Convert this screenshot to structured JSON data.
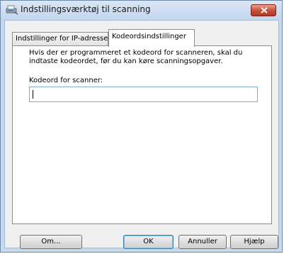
{
  "window": {
    "title": "Indstillingsværktøj til scanning"
  },
  "tabs": [
    {
      "label": "Indstillinger for IP-adresse",
      "active": false
    },
    {
      "label": "Kodeordsindstillinger",
      "active": true
    }
  ],
  "panel": {
    "description": "Hvis der er programmeret et kodeord for scanneren, skal du indtaste kodeordet, før du kan køre scanningsopgaver.",
    "password_label": "Kodeord for scanner:",
    "password_value": ""
  },
  "buttons": {
    "about": "Om...",
    "ok": "OK",
    "cancel": "Annuller",
    "help": "Hjælp"
  },
  "colors": {
    "frame": "#c7d9ee",
    "close_button": "#c7513c",
    "focus_border": "#3c7fb1"
  },
  "icons": {
    "title": "scanner-icon",
    "close": "close-icon"
  }
}
